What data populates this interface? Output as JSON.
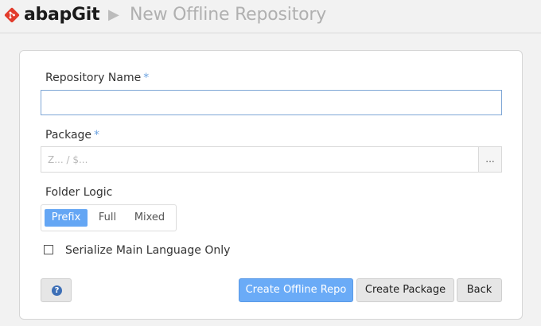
{
  "header": {
    "brand": "abapGit",
    "separator": "▶",
    "title": "New Offline Repository",
    "logo_icon": "abapgit-logo-icon",
    "colors": {
      "logo": "#e23b2b"
    }
  },
  "form": {
    "repo_name": {
      "label": "Repository Name",
      "required_mark": "*",
      "value": "",
      "placeholder": ""
    },
    "package": {
      "label": "Package",
      "required_mark": "*",
      "value": "",
      "placeholder": "Z... / $...",
      "browse_label": "..."
    },
    "folder_logic": {
      "label": "Folder Logic",
      "options": [
        "Prefix",
        "Full",
        "Mixed"
      ],
      "selected": "Prefix"
    },
    "serialize_main_lang": {
      "label": "Serialize Main Language Only",
      "checked": false
    }
  },
  "buttons": {
    "help_icon": "question-circle-icon",
    "help_glyph": "?",
    "create_offline": "Create Offline Repo",
    "create_package": "Create Package",
    "back": "Back"
  },
  "colors": {
    "accent": "#64a6f4",
    "required": "#6ba2e0",
    "help_icon": "#3d6fb6"
  }
}
